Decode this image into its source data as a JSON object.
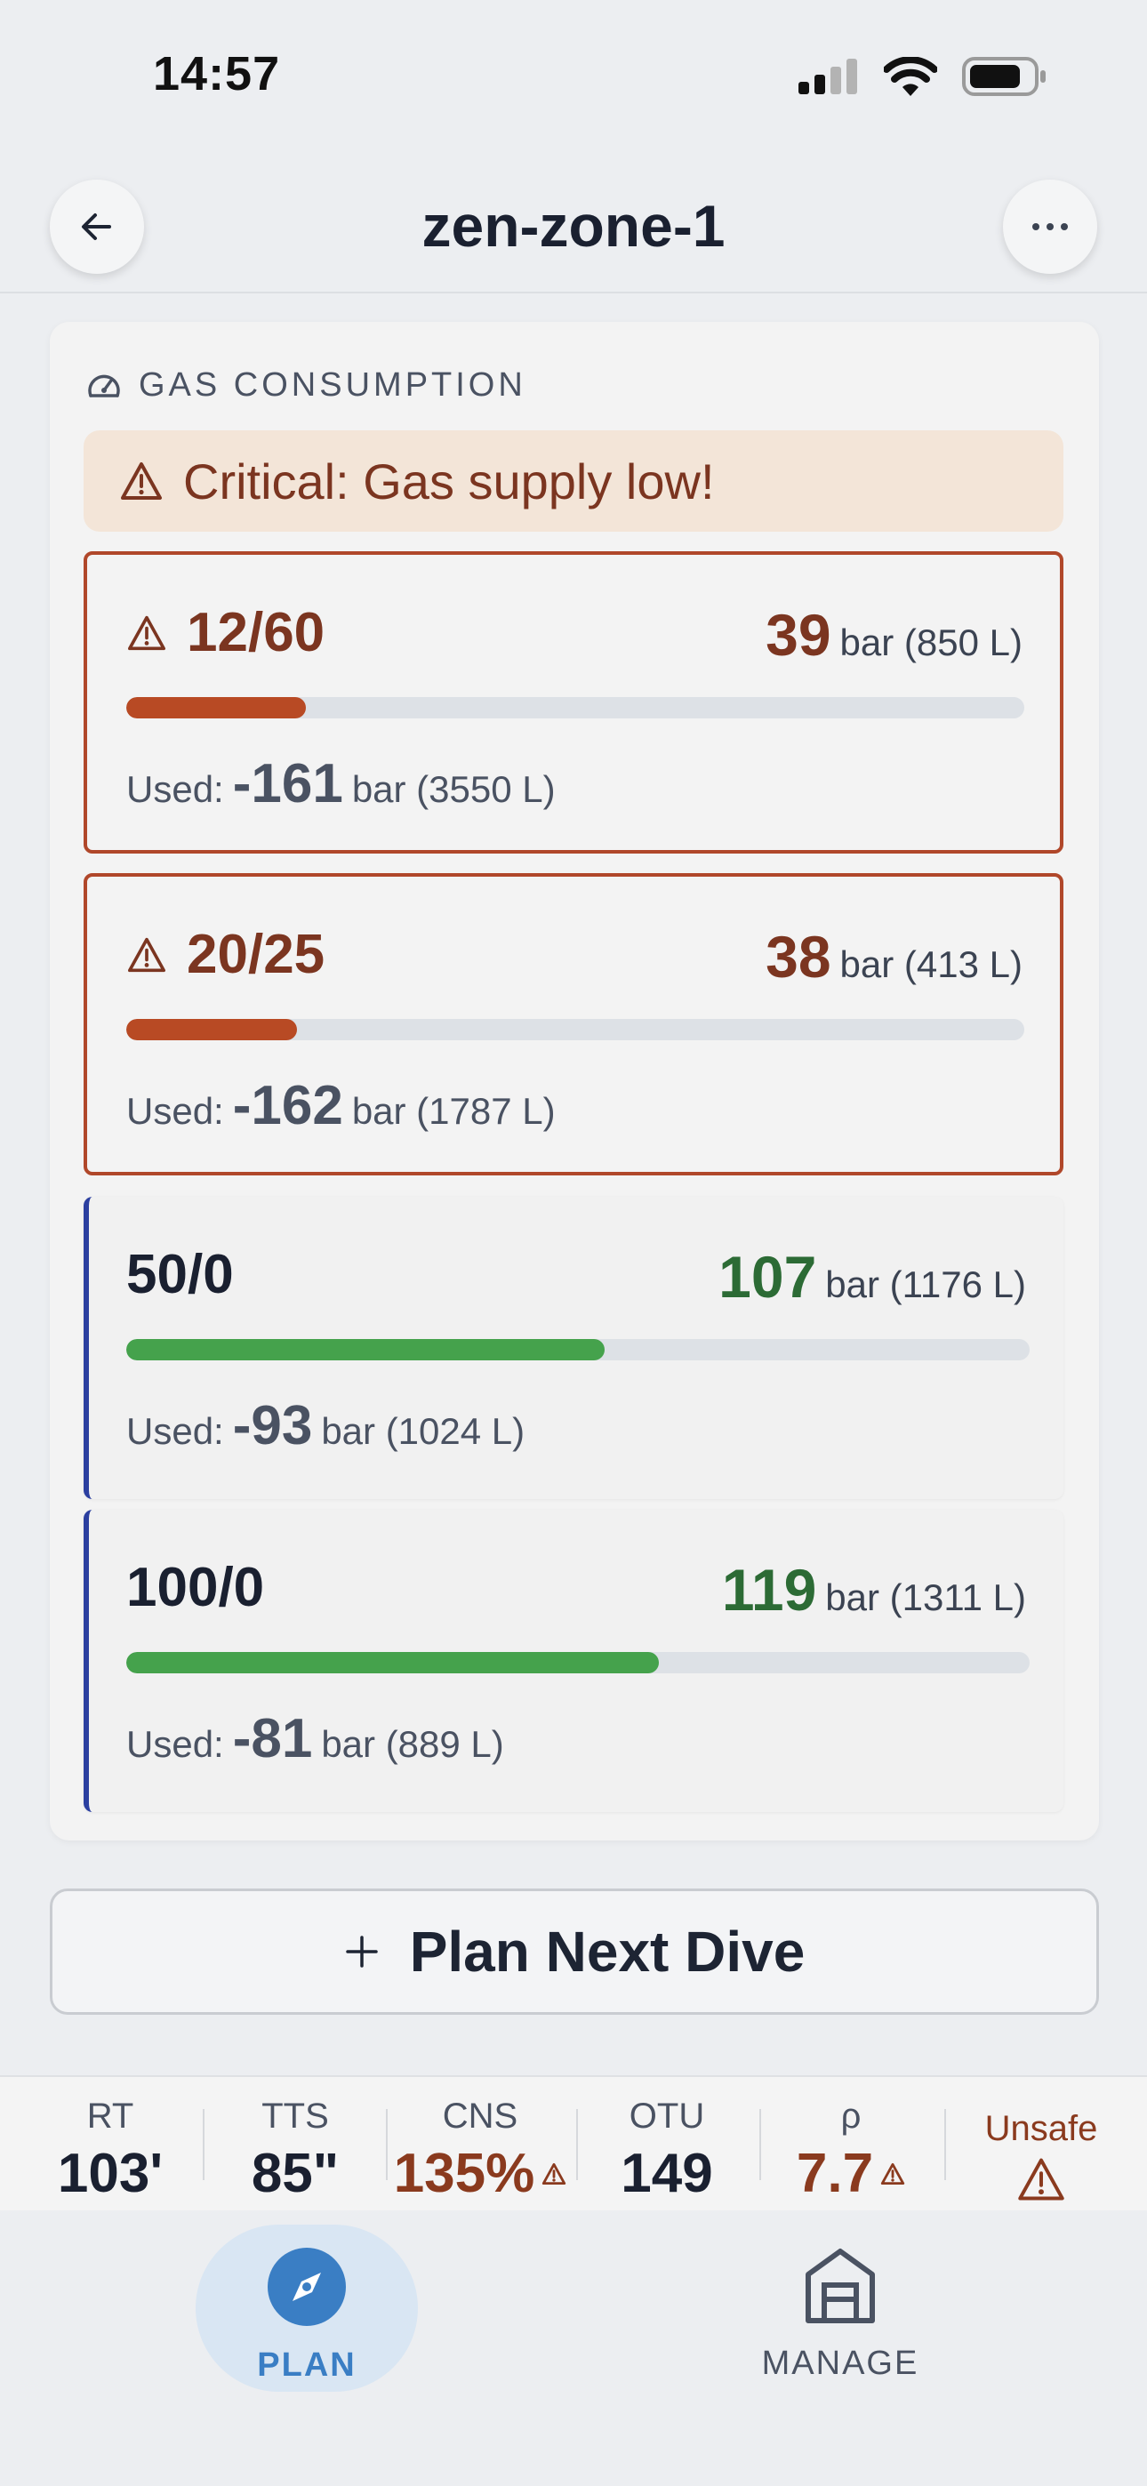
{
  "status_bar": {
    "time": "14:57"
  },
  "header": {
    "title": "zen-zone-1"
  },
  "gas_section": {
    "title": "GAS CONSUMPTION",
    "alert": "Critical: Gas supply low!",
    "used_label": "Used:",
    "gases": [
      {
        "name": "12/60",
        "remaining": "39",
        "remaining_unit": "bar (850 L)",
        "used": "-161",
        "used_unit": "bar (3550 L)",
        "fill_percent": 20,
        "critical": true
      },
      {
        "name": "20/25",
        "remaining": "38",
        "remaining_unit": "bar (413 L)",
        "used": "-162",
        "used_unit": "bar (1787 L)",
        "fill_percent": 19,
        "critical": true
      },
      {
        "name": "50/0",
        "remaining": "107",
        "remaining_unit": "bar (1176 L)",
        "used": "-93",
        "used_unit": "bar (1024 L)",
        "fill_percent": 53,
        "critical": false
      },
      {
        "name": "100/0",
        "remaining": "119",
        "remaining_unit": "bar (1311 L)",
        "used": "-81",
        "used_unit": "bar (889 L)",
        "fill_percent": 59,
        "critical": false
      }
    ]
  },
  "plan_button": {
    "label": "Plan Next Dive"
  },
  "stats": {
    "rt": {
      "label": "RT",
      "value": "103'"
    },
    "tts": {
      "label": "TTS",
      "value": "85\""
    },
    "cns": {
      "label": "CNS",
      "value": "135%"
    },
    "otu": {
      "label": "OTU",
      "value": "149"
    },
    "rho": {
      "label": "ρ",
      "value": "7.7"
    },
    "unsafe": {
      "label": "Unsafe"
    }
  },
  "tabs": {
    "plan": "PLAN",
    "manage": "MANAGE"
  },
  "colors": {
    "critical": "#b0472a",
    "ok_fill": "#45a24c",
    "accent": "#3a7ec4",
    "cylinder_edge": "#2b3fa0"
  }
}
